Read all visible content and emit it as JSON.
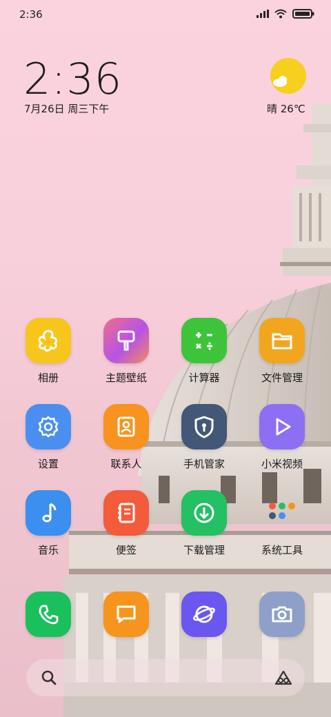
{
  "status_bar": {
    "time": "2:36"
  },
  "clock_widget": {
    "time": "2:36",
    "date": "7月26日 周三下午"
  },
  "weather_widget": {
    "text": "晴 26℃",
    "icon": "partly-sunny-icon"
  },
  "apps": [
    {
      "label": "相册",
      "icon": "gallery-icon",
      "color": "#f7c51c"
    },
    {
      "label": "主题壁纸",
      "icon": "themes-brush-icon",
      "color": "#e6588f"
    },
    {
      "label": "计算器",
      "icon": "calculator-icon",
      "color": "#3ec43b"
    },
    {
      "label": "文件管理",
      "icon": "folder-icon",
      "color": "#f2a51f"
    },
    {
      "label": "设置",
      "icon": "gear-icon",
      "color": "#4a8ff0"
    },
    {
      "label": "联系人",
      "icon": "contacts-icon",
      "color": "#f7931e"
    },
    {
      "label": "手机管家",
      "icon": "security-shield-icon",
      "color": "#435777"
    },
    {
      "label": "小米视频",
      "icon": "video-play-icon",
      "color": "#8c6ff2"
    },
    {
      "label": "音乐",
      "icon": "music-note-icon",
      "color": "#3a8fef"
    },
    {
      "label": "便签",
      "icon": "notes-icon",
      "color": "#f45b3a"
    },
    {
      "label": "下载管理",
      "icon": "download-icon",
      "color": "#23c064"
    },
    {
      "label": "系统工具",
      "icon": "folder-system-tools-icon",
      "color": "#f5f5f5"
    }
  ],
  "dock": [
    {
      "icon": "phone-icon",
      "color": "#19c05c"
    },
    {
      "icon": "message-icon",
      "color": "#f7941d"
    },
    {
      "icon": "browser-icon",
      "color": "#6a57f0"
    },
    {
      "icon": "camera-icon",
      "color": "#8ea0c9"
    }
  ]
}
